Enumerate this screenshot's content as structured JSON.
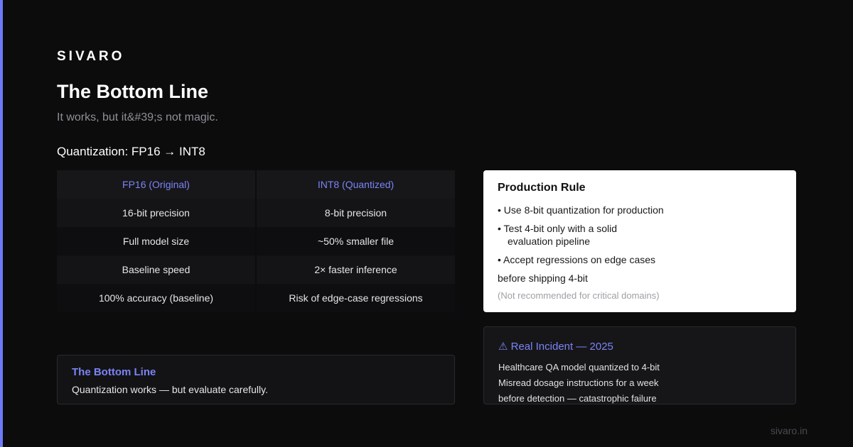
{
  "brand": "SIVARO",
  "title": "The Bottom Line",
  "subtitle": "It works, but it&#39;s not magic.",
  "section_title": "Quantization: FP16 → INT8",
  "comparison": {
    "headers": [
      "FP16 (Original)",
      "INT8 (Quantized)"
    ],
    "rows": [
      [
        "16-bit precision",
        "8-bit precision"
      ],
      [
        "Full model size",
        "~50% smaller file"
      ],
      [
        "Baseline speed",
        "2× faster inference"
      ],
      [
        "100% accuracy (baseline)",
        "Risk of edge-case regressions"
      ]
    ]
  },
  "production_rule": {
    "title": "Production Rule",
    "line1": "• Use 8-bit quantization for production",
    "line2a": "• Test 4-bit only with a solid",
    "line2b": "evaluation pipeline",
    "line3": "• Accept regressions on edge cases",
    "line4": "before shipping 4-bit",
    "note": "(Not recommended for critical domains)"
  },
  "incident": {
    "title": "⚠ Real Incident — 2025",
    "lines": [
      "Healthcare QA model quantized to 4-bit",
      "Misread dosage instructions for a week",
      "before detection — catastrophic failure"
    ]
  },
  "bottom_line": {
    "title": "The Bottom Line",
    "text": "Quantization works — but evaluate carefully."
  },
  "footer": "sivaro.in",
  "colors": {
    "background": "#0c0c0d",
    "accent": "#6f7af8",
    "card_light": "#ffffff"
  }
}
